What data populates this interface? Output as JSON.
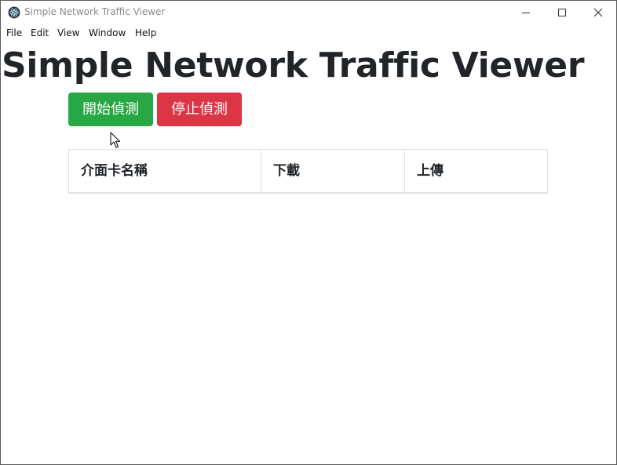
{
  "window": {
    "title": "Simple Network Traffic Viewer",
    "icon": "electron-app-icon"
  },
  "menu": {
    "items": [
      "File",
      "Edit",
      "View",
      "Window",
      "Help"
    ]
  },
  "main": {
    "heading": "Simple Network Traffic Viewer",
    "start_button_label": "開始偵測",
    "stop_button_label": "停止偵測",
    "table": {
      "columns": [
        "介面卡名稱",
        "下載",
        "上傳"
      ],
      "rows": []
    }
  },
  "colors": {
    "start_button": "#28a745",
    "stop_button": "#dc3545",
    "heading_text": "#212529",
    "table_border": "#dee2e6"
  }
}
